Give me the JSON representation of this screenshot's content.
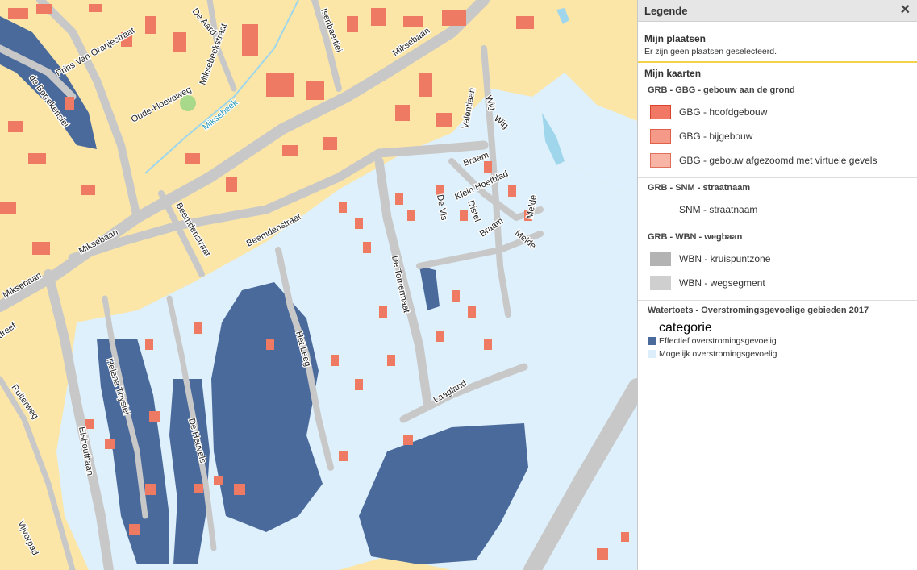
{
  "legend": {
    "title": "Legende",
    "my_places": {
      "title": "Mijn plaatsen",
      "message": "Er zijn geen plaatsen geselecteerd."
    },
    "my_maps_title": "Mijn kaarten",
    "layers": [
      {
        "title": "GRB - GBG - gebouw aan de grond",
        "items": [
          {
            "label": "GBG - hoofdgebouw",
            "fill": "#f07864",
            "border": "#d9432b"
          },
          {
            "label": "GBG - bijgebouw",
            "fill": "#f59a88",
            "border": "#e0604a"
          },
          {
            "label": "GBG - gebouw afgezoomd met virtuele gevels",
            "fill": "#f8b5a6",
            "border": "#e0705c"
          }
        ]
      },
      {
        "title": "GRB - SNM - straatnaam",
        "items": [
          {
            "label": "SNM - straatnaam",
            "fill": "transparent",
            "border": "transparent"
          }
        ]
      },
      {
        "title": "GRB - WBN - wegbaan",
        "items": [
          {
            "label": "WBN - kruispuntzone",
            "fill": "#b3b3b3",
            "border": "#b3b3b3"
          },
          {
            "label": "WBN - wegsegment",
            "fill": "#cfcfcf",
            "border": "#cfcfcf"
          }
        ]
      }
    ],
    "watertoets": {
      "title": "Watertoets - Overstromingsgevoelige gebieden 2017",
      "category_label": "categorie",
      "items": [
        {
          "label": "Effectief overstromingsgevoelig",
          "fill": "#4a6a9c"
        },
        {
          "label": "Mogelijk overstromingsgevoelig",
          "fill": "#dceefa"
        }
      ]
    }
  },
  "map": {
    "colors": {
      "base": "#fbe6a8",
      "possible_flood": "#def0fb",
      "effective_flood": "#4a6a9c",
      "road": "#c8c8c8",
      "building": "#ef7a63",
      "water": "#9fd6ec"
    },
    "street_labels": {
      "prins_van_oranjestraat": "Prins Van Oranjestraat",
      "de_aard": "De Aard",
      "isenbaertlei": "Isenbaertlei",
      "miksebaan_top": "Miksebaan",
      "de_borrekenslei": "de Borrekenslei",
      "oude_hoeveweg": "Oude-Hoeveweg",
      "mikse_beekstraat": "Miksebeekstraat",
      "miksebeek": "Miksebeek",
      "valentiaan": "Valentiaan",
      "wig_1": "Wig",
      "wig_2": "Wig",
      "braam_1": "Braam",
      "klein_hoefblad": "Klein Hoefblad",
      "de_vis": "De Vis",
      "distel": "Distel",
      "braam_2": "Braam",
      "melde_1": "Melde",
      "melde_2": "Melde",
      "beemdenstraat_1": "Beemdenstraat",
      "beemdenstraat_2": "Beemdenstraat",
      "miksebaan_left": "Miksebaan",
      "miksebaan_mid": "Miksebaan",
      "de_tomermaat": "De Tomermaat",
      "het_leeg": "Het Leeg",
      "helena_thyslei": "Helena Thyslei",
      "de_heuvels": "De Heuvels",
      "laagland": "Laagland",
      "elshoutbaan": "Elshoutbaan",
      "ruiterweg": "Ruiterweg",
      "dreef": "dreef",
      "vijverpad": "Vijverpad"
    }
  }
}
